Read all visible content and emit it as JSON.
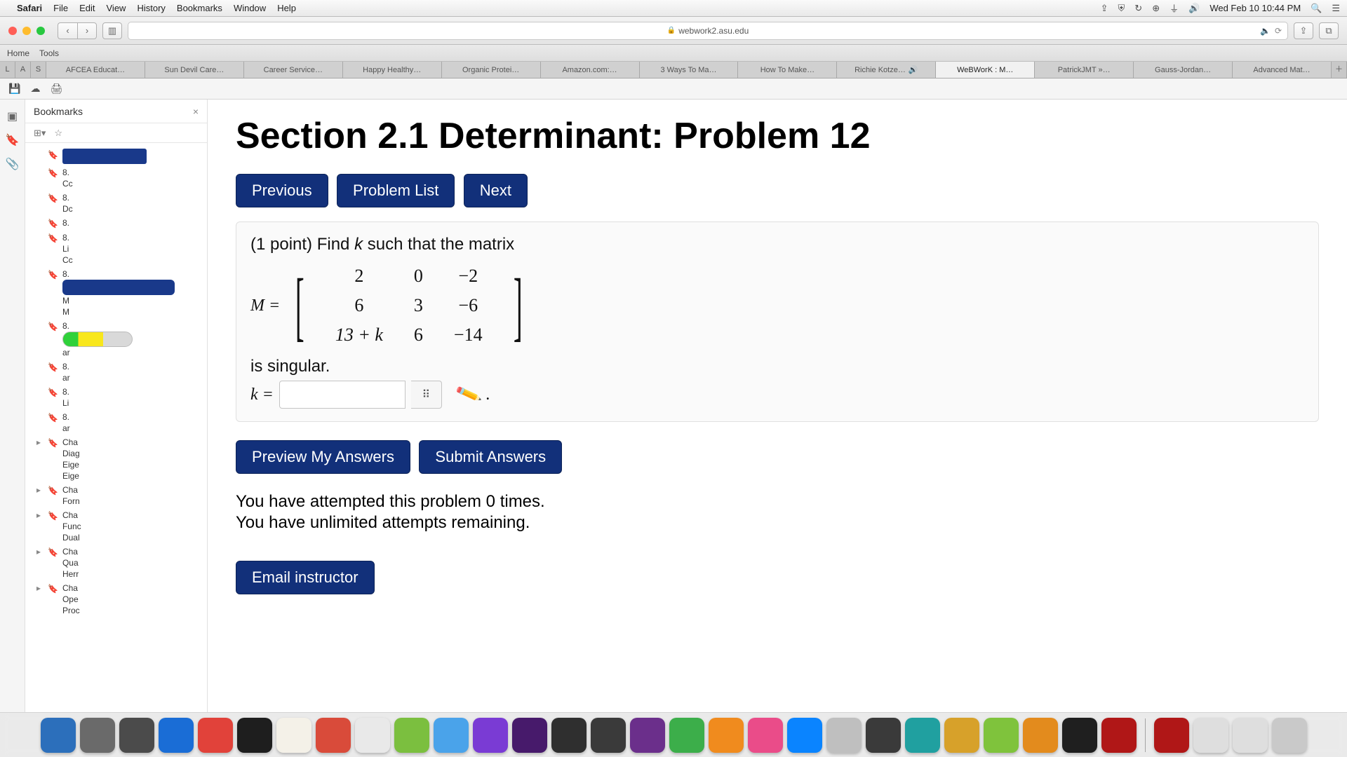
{
  "menubar": {
    "app": "Safari",
    "items": [
      "File",
      "Edit",
      "View",
      "History",
      "Bookmarks",
      "Window",
      "Help"
    ],
    "clock": "Wed Feb 10 10:44 PM"
  },
  "toolbar": {
    "home": "Home",
    "tools": "Tools"
  },
  "url": "webwork2.asu.edu",
  "browser_tabs": [
    {
      "label": "AFCEA Educat…"
    },
    {
      "label": "Sun Devil Care…"
    },
    {
      "label": "Career Service…"
    },
    {
      "label": "Happy Healthy…"
    },
    {
      "label": "Organic Protei…"
    },
    {
      "label": "Amazon.com:…"
    },
    {
      "label": "3 Ways To Ma…"
    },
    {
      "label": "How To Make…"
    },
    {
      "label": "Richie Kotze…",
      "sound": true
    },
    {
      "label": "WeBWorK : M…",
      "active": true
    },
    {
      "label": "PatrickJMT »…"
    },
    {
      "label": "Gauss-Jordan…"
    },
    {
      "label": "Advanced Mat…"
    }
  ],
  "bookmarks": {
    "title": "Bookmarks",
    "items": [
      {
        "label": "",
        "highlight": "blue"
      },
      {
        "label": "8.",
        "sub": [
          "Cc"
        ]
      },
      {
        "label": "8.",
        "sub": [
          "Dc"
        ]
      },
      {
        "label": "8.",
        "sub": []
      },
      {
        "label": "8.",
        "sub": [
          "Li",
          "Cc"
        ]
      },
      {
        "label": "8.",
        "sub": [
          "M",
          "M"
        ],
        "highlight": "blue-long"
      },
      {
        "label": "8.",
        "sub": [
          "ar"
        ],
        "highlight": "progress"
      },
      {
        "label": "8.",
        "sub": [
          "ar"
        ]
      },
      {
        "label": "8.",
        "sub": [
          "Li"
        ]
      },
      {
        "label": "8.",
        "sub": [
          "ar"
        ]
      },
      {
        "label": "Cha",
        "sub": [
          "Diag",
          "Eige",
          "Eige"
        ],
        "disclosure": true
      },
      {
        "label": "Cha",
        "sub": [
          "Forn"
        ],
        "disclosure": true
      },
      {
        "label": "Cha",
        "sub": [
          "Func",
          "Dual"
        ],
        "disclosure": true
      },
      {
        "label": "Cha",
        "sub": [
          "Qua",
          "Herr"
        ],
        "disclosure": true
      },
      {
        "label": "Cha",
        "sub": [
          "Ope",
          "Proc"
        ],
        "disclosure": true
      }
    ]
  },
  "page": {
    "title": "Section 2.1 Determinant: Problem 12",
    "nav": {
      "prev": "Previous",
      "list": "Problem List",
      "next": "Next"
    },
    "lead_prefix": "(1 point) Find ",
    "lead_var": "k",
    "lead_suffix": " such that the matrix",
    "matrix_label": "M =",
    "matrix": [
      [
        "2",
        "0",
        "−2"
      ],
      [
        "6",
        "3",
        "−6"
      ],
      [
        "13 + k",
        "6",
        "−14"
      ]
    ],
    "post_text": "is singular.",
    "answer_label": "k =",
    "preview": "Preview My Answers",
    "submit": "Submit Answers",
    "attempts_line": "You have attempted this problem 0 times.",
    "remaining_line": "You have unlimited attempts remaining.",
    "email": "Email instructor"
  },
  "chart_data": {
    "type": "table",
    "title": "Matrix M for determinant problem",
    "rows": [
      [
        2,
        0,
        -2
      ],
      [
        6,
        3,
        -6
      ],
      [
        "13 + k",
        6,
        -14
      ]
    ],
    "unknown": "k",
    "condition": "det(M) = 0"
  },
  "dock_colors": [
    "#2c6fbb",
    "#6a6a6a",
    "#4b4b4b",
    "#1a6dd6",
    "#e1423a",
    "#1e1e1e",
    "#f4f1e8",
    "#d94b3a",
    "#e9e9e9",
    "#7bbf3f",
    "#4aa3ea",
    "#7a3bd4",
    "#471a6b",
    "#2f2f2f",
    "#3a3a3a",
    "#6b2f8b",
    "#3cae4a",
    "#f08b1e",
    "#ea4c89",
    "#0a84ff",
    "#bfbfbf",
    "#3a3a3a",
    "#20a0a0",
    "#d7a12a",
    "#7fc33c",
    "#e38b1d",
    "#1f1f1f",
    "#b01717",
    "#b01717",
    "#dedede",
    "#dedede",
    "#c9c9c9"
  ]
}
